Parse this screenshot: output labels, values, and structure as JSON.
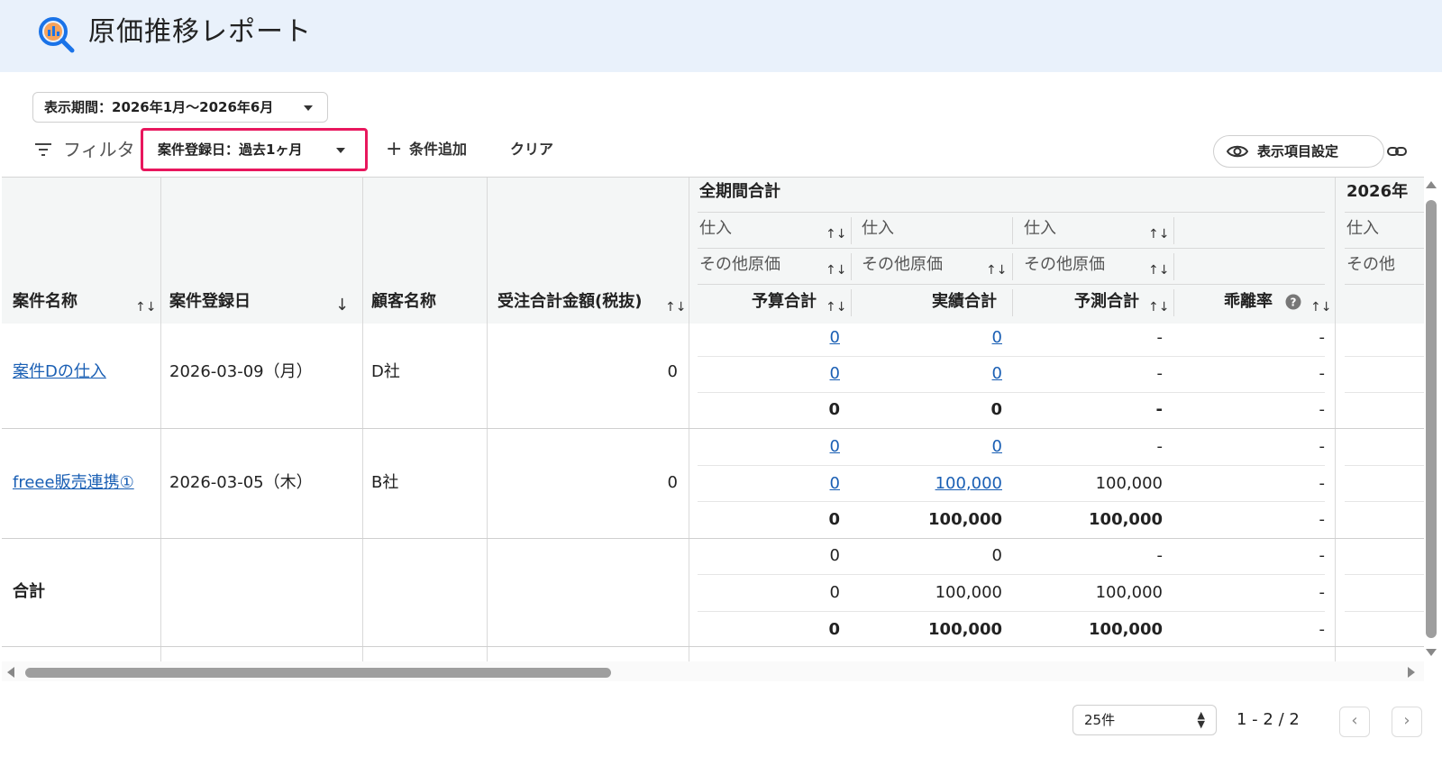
{
  "header": {
    "title": "原価推移レポート",
    "icon": "report-search-icon",
    "accent": "#1a73e8"
  },
  "period": {
    "label": "表示期間：2026年1月〜2026年6月"
  },
  "filter": {
    "label": "フィルタ",
    "chip": "案件登録日：過去1ヶ月",
    "add_condition": "条件追加",
    "clear": "クリア",
    "display_settings": "表示項目設定"
  },
  "table": {
    "columns": {
      "name": "案件名称",
      "reg_date": "案件登録日",
      "customer": "顧客名称",
      "order_total": "受注合計金額(税抜)"
    },
    "group_all": "全期間合計",
    "group_2026": "2026年",
    "sub1": [
      "仕入",
      "仕入",
      "仕入",
      "仕入"
    ],
    "sub2": [
      "その他原価",
      "その他原価",
      "その他原価",
      "その他"
    ],
    "metrics": [
      "予算合計",
      "実績合計",
      "予測合計",
      "乖離率"
    ],
    "rows": [
      {
        "name": "案件Dの仕入",
        "reg_date": "2026-03-09（月）",
        "customer": "D社",
        "order_total": "0",
        "lines": [
          [
            "0",
            "0",
            "-",
            "-"
          ],
          [
            "0",
            "0",
            "-",
            "-"
          ],
          [
            "0",
            "0",
            "-",
            "-"
          ]
        ]
      },
      {
        "name": "freee販売連携①",
        "reg_date": "2026-03-05（木）",
        "customer": "B社",
        "order_total": "0",
        "lines": [
          [
            "0",
            "0",
            "-",
            "-"
          ],
          [
            "0",
            "100,000",
            "100,000",
            "-"
          ],
          [
            "0",
            "100,000",
            "100,000",
            "-"
          ]
        ]
      }
    ],
    "total": {
      "label": "合計",
      "lines": [
        [
          "0",
          "0",
          "-",
          "-"
        ],
        [
          "0",
          "100,000",
          "100,000",
          "-"
        ],
        [
          "0",
          "100,000",
          "100,000",
          "-"
        ]
      ]
    }
  },
  "pagination": {
    "page_size": "25件",
    "info": "1 - 2 / 2",
    "prev": "‹",
    "next": "›"
  },
  "colors": {
    "highlight": "#e8175d",
    "link": "#1a5fb4",
    "header_bg": "#e9f1fb"
  }
}
